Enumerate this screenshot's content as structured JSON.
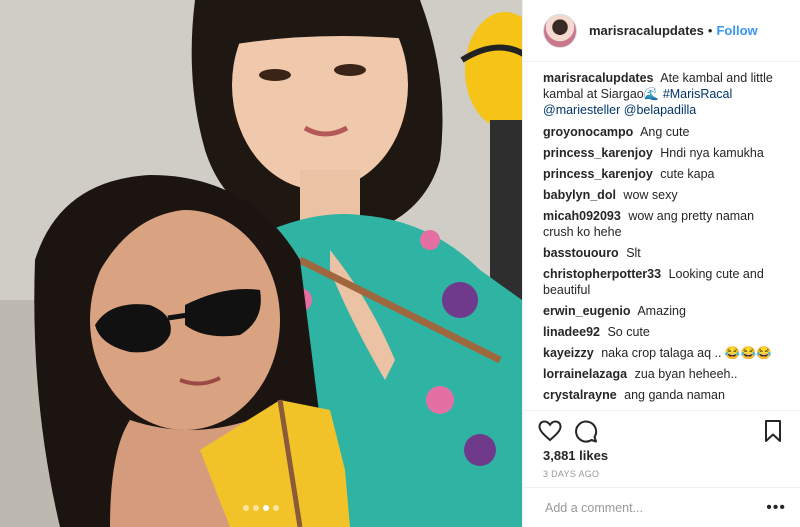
{
  "post": {
    "username": "marisracalupdates",
    "separator": "•",
    "follow_label": "Follow",
    "caption": {
      "user": "marisracalupdates",
      "text": "Ate kambal and little kambal at Siargao🌊",
      "hashtag": "#MarisRacal",
      "mentions": "@mariesteller @belapadilla"
    },
    "comments": [
      {
        "user": "groyonocampo",
        "text": "Ang cute"
      },
      {
        "user": "princess_karenjoy",
        "text": "Hndi nya kamukha"
      },
      {
        "user": "princess_karenjoy",
        "text": "cute kapa"
      },
      {
        "user": "babylyn_dol",
        "text": "wow sexy"
      },
      {
        "user": "micah092093",
        "text": "wow ang pretty naman crush ko hehe"
      },
      {
        "user": "basstououro",
        "text": "Slt"
      },
      {
        "user": "christopherpotter33",
        "text": "Looking cute and beautiful"
      },
      {
        "user": "erwin_eugenio",
        "text": "Amazing"
      },
      {
        "user": "linadee92",
        "text": "So cute"
      },
      {
        "user": "kayeizzy",
        "text": "naka crop talaga aq .. 😂😂😂"
      },
      {
        "user": "lorrainelazaga",
        "text": "zua byan heheeh.."
      },
      {
        "user": "crystalrayne",
        "text": "ang ganda naman"
      }
    ],
    "likes": "3,881 likes",
    "time": "3 DAYS AGO",
    "add_comment_placeholder": "Add a comment...",
    "more_label": "•••",
    "carousel": {
      "count": 4,
      "active": 3
    }
  },
  "icons": {
    "like": "heart-icon",
    "comment": "comment-icon",
    "save": "bookmark-icon"
  }
}
